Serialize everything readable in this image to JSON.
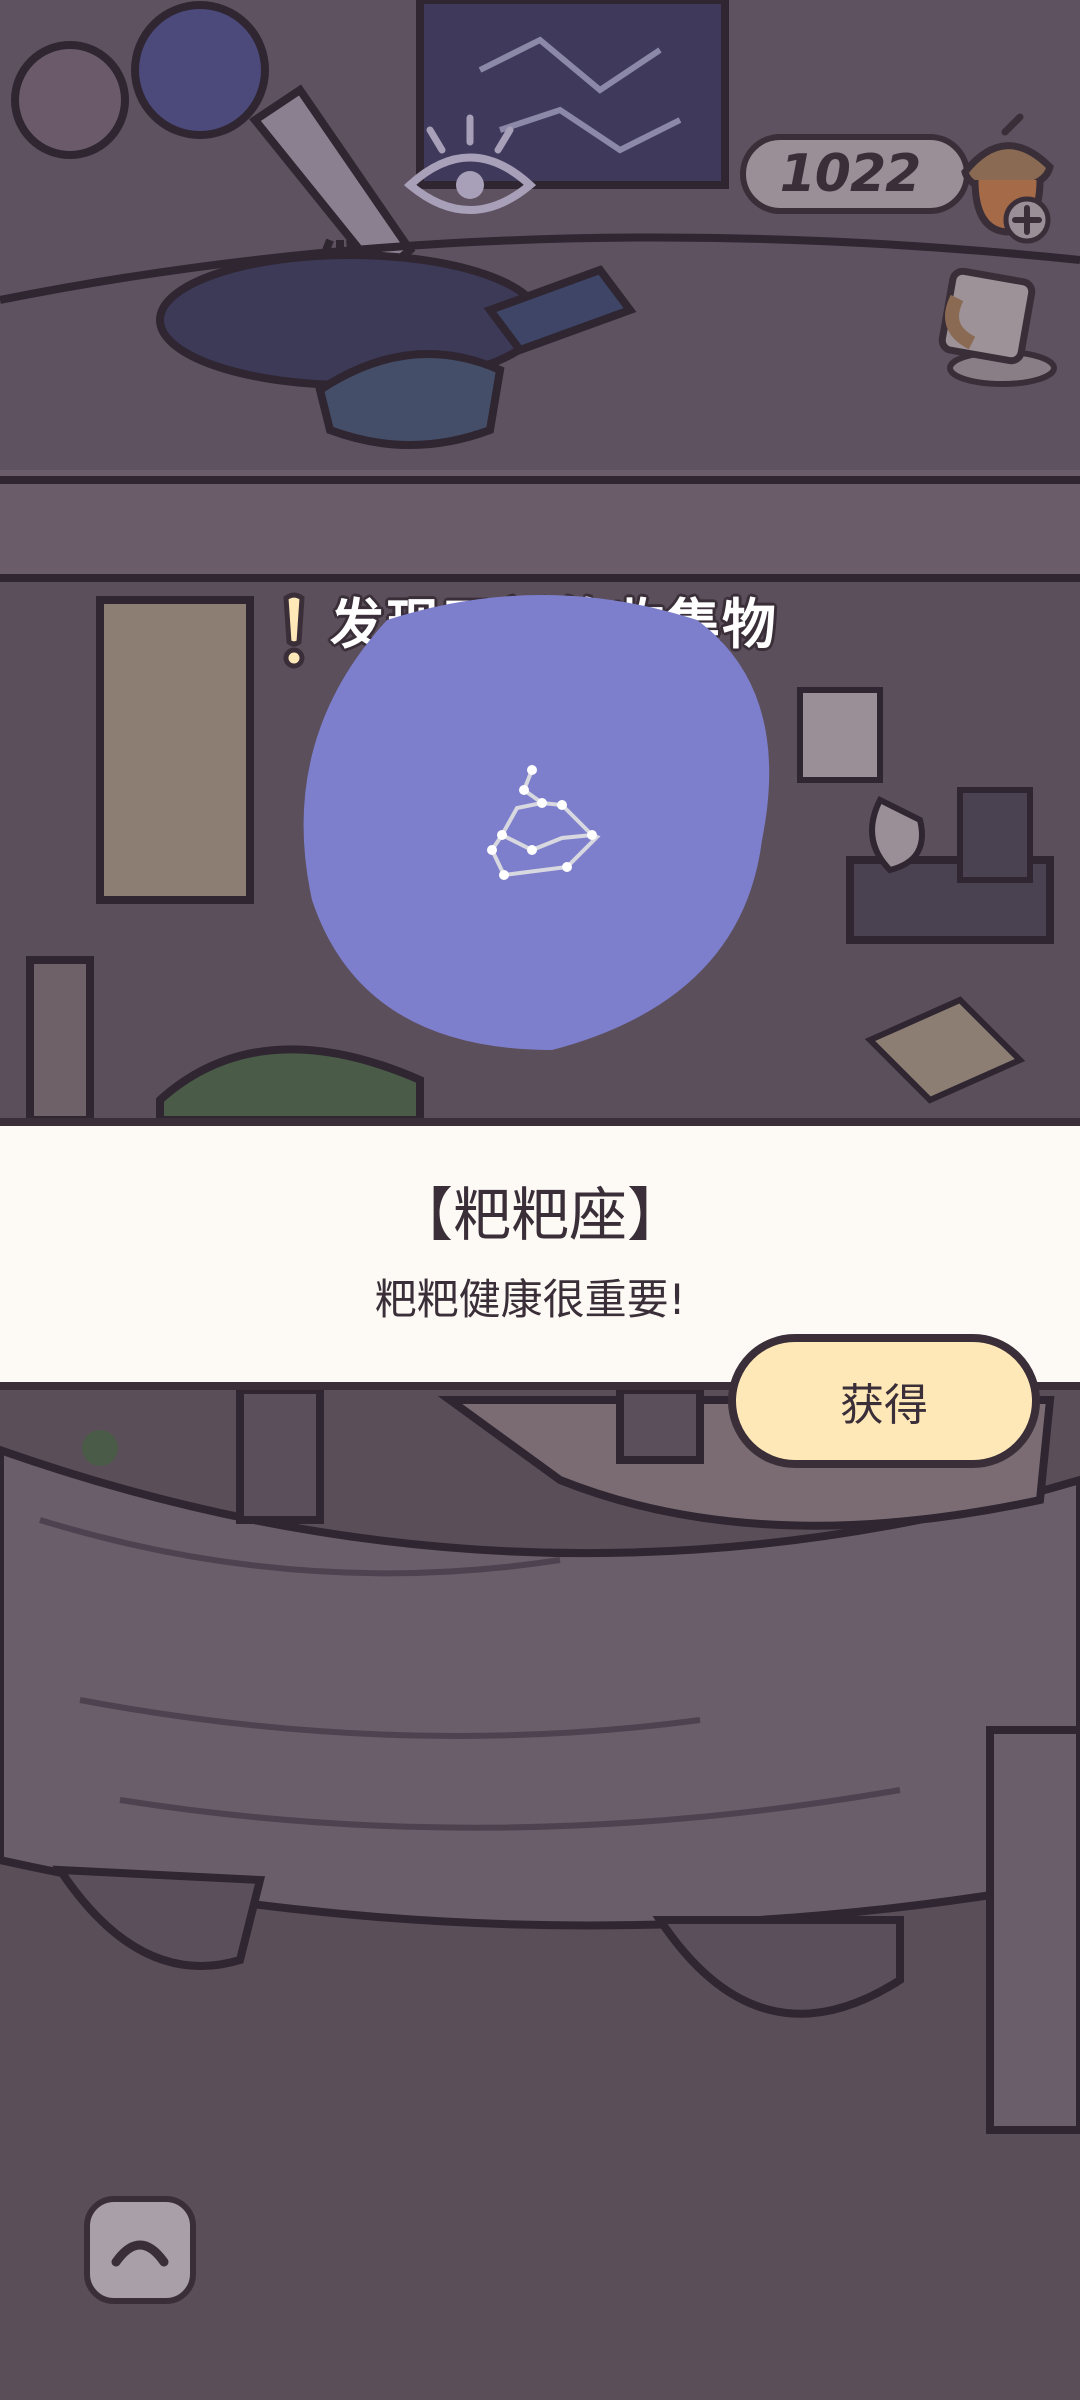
{
  "currency": {
    "value": "1022",
    "icon": "acorn-icon",
    "add_icon": "plus-icon"
  },
  "discovery": {
    "title": "发现了新的收集物",
    "icon": "exclamation-icon"
  },
  "collectible": {
    "name": "【粑粑座】",
    "description": "粑粑健康很重要!",
    "icon": "poop-constellation-icon",
    "card_color": "#7d7fcc"
  },
  "actions": {
    "obtain_label": "获得",
    "expand_icon": "chevron-up-icon"
  },
  "colors": {
    "overlay": "#5a4e58",
    "outline": "#3a2f38",
    "button": "#ffe8b8",
    "panel": "#fdfaf5"
  }
}
